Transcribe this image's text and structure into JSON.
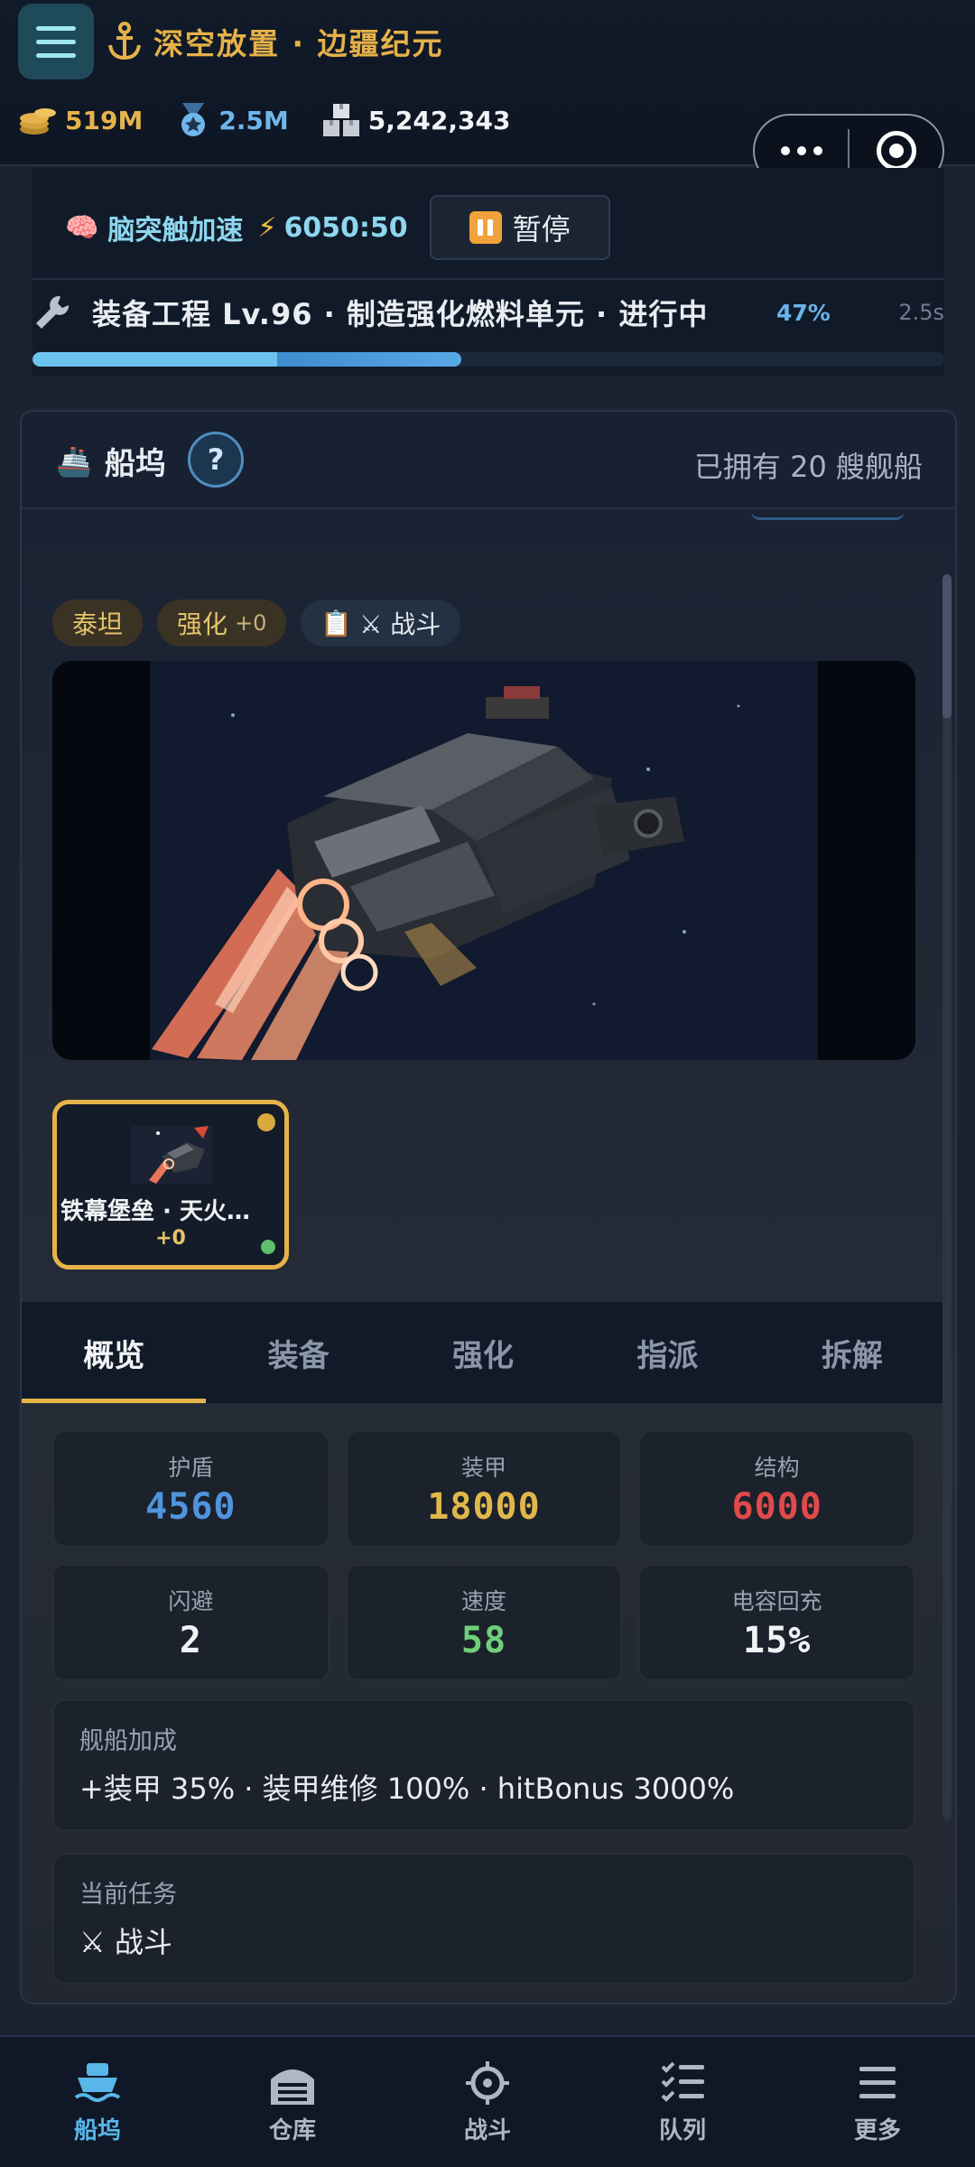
{
  "header": {
    "title": "深空放置 · 边疆纪元",
    "resources": [
      {
        "icon": "coins-icon",
        "value": "519M"
      },
      {
        "icon": "medal-icon",
        "value": "2.5M"
      },
      {
        "icon": "crates-icon",
        "value": "5,242,343"
      }
    ]
  },
  "boost": {
    "label": "脑突触加速",
    "timer": "6050:50",
    "pause_label": "暂停"
  },
  "task": {
    "text": "装备工程 Lv.96 · 制造强化燃料单元 · 进行中",
    "percent_label": "47%",
    "time": "2.5s",
    "progress": 0.47
  },
  "dock": {
    "title": "船坞",
    "help": "?",
    "owned": "已拥有 20 艘舰船",
    "tags": {
      "class": "泰坦",
      "enhance": "强化",
      "enhance_level": "+0",
      "task": "⚔ 战斗"
    },
    "thumbnail": {
      "name": "铁幕堡垒 · 天火…",
      "level": "+0"
    },
    "tabs": [
      "概览",
      "装备",
      "强化",
      "指派",
      "拆解"
    ],
    "stats": [
      {
        "label": "护盾",
        "value": "4560"
      },
      {
        "label": "装甲",
        "value": "18000"
      },
      {
        "label": "结构",
        "value": "6000"
      },
      {
        "label": "闪避",
        "value": "2"
      },
      {
        "label": "速度",
        "value": "58"
      },
      {
        "label": "电容回充",
        "value": "15%"
      }
    ],
    "bonus": {
      "label": "舰船加成",
      "value": "+装甲 35% · 装甲维修 100% · hitBonus 3000%"
    },
    "mission": {
      "label": "当前任务",
      "value": "⚔ 战斗"
    }
  },
  "nav": [
    "船坞",
    "仓库",
    "战斗",
    "队列",
    "更多"
  ],
  "colors": {
    "accent_gold": "#e6b348",
    "accent_blue": "#59b6e8",
    "shield": "#4f94de",
    "armor": "#e0b74a",
    "structure": "#e04a4a",
    "speed": "#6ed07a"
  }
}
